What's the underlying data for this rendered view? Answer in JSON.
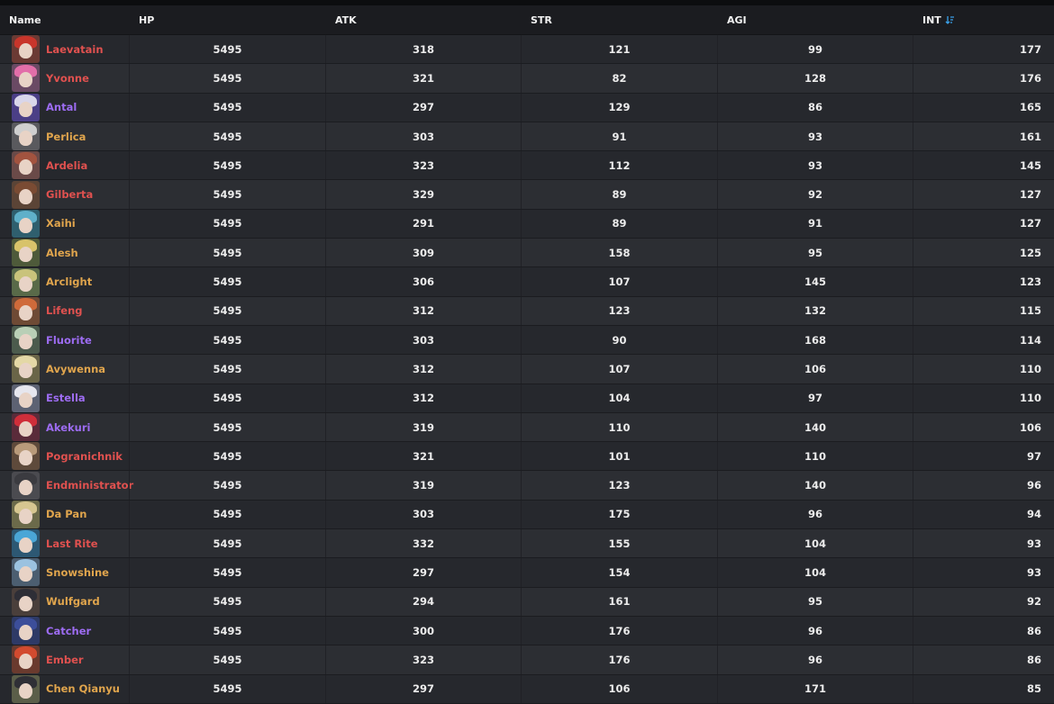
{
  "colors": {
    "red": "#e0514f",
    "purple": "#9d6cf2",
    "gold": "#e0a54d",
    "sort_accent": "#3aa0e8"
  },
  "columns": {
    "name": "Name",
    "hp": "HP",
    "atk": "ATK",
    "str": "STR",
    "agi": "AGI",
    "int": "INT"
  },
  "sort": {
    "column": "INT",
    "direction": "descending",
    "icon": "sort-descending-icon"
  },
  "rows": [
    {
      "name": "Laevatain",
      "rarity": "red",
      "hp": "5495",
      "atk": "318",
      "str": "121",
      "agi": "99",
      "int": "177",
      "avatar": {
        "hair": "#c8352b",
        "bg": "#6b3a34"
      }
    },
    {
      "name": "Yvonne",
      "rarity": "red",
      "hp": "5495",
      "atk": "321",
      "str": "82",
      "agi": "128",
      "int": "176",
      "avatar": {
        "hair": "#e26ea9",
        "bg": "#6a4a64"
      }
    },
    {
      "name": "Antal",
      "rarity": "purple",
      "hp": "5495",
      "atk": "297",
      "str": "129",
      "agi": "86",
      "int": "165",
      "avatar": {
        "hair": "#d9d6ea",
        "bg": "#4b3f86"
      }
    },
    {
      "name": "Perlica",
      "rarity": "gold",
      "hp": "5495",
      "atk": "303",
      "str": "91",
      "agi": "93",
      "int": "161",
      "avatar": {
        "hair": "#cfcfcf",
        "bg": "#5a5a5e"
      }
    },
    {
      "name": "Ardelia",
      "rarity": "red",
      "hp": "5495",
      "atk": "323",
      "str": "112",
      "agi": "93",
      "int": "145",
      "avatar": {
        "hair": "#a2533f",
        "bg": "#6a4a48"
      }
    },
    {
      "name": "Gilberta",
      "rarity": "red",
      "hp": "5495",
      "atk": "329",
      "str": "89",
      "agi": "92",
      "int": "127",
      "avatar": {
        "hair": "#7a4b33",
        "bg": "#5b4436"
      }
    },
    {
      "name": "Xaihi",
      "rarity": "gold",
      "hp": "5495",
      "atk": "291",
      "str": "89",
      "agi": "91",
      "int": "127",
      "avatar": {
        "hair": "#5fb0c9",
        "bg": "#2f5f6e"
      }
    },
    {
      "name": "Alesh",
      "rarity": "gold",
      "hp": "5495",
      "atk": "309",
      "str": "158",
      "agi": "95",
      "int": "125",
      "avatar": {
        "hair": "#d8c36a",
        "bg": "#4e5a3a"
      }
    },
    {
      "name": "Arclight",
      "rarity": "gold",
      "hp": "5495",
      "atk": "306",
      "str": "107",
      "agi": "145",
      "int": "123",
      "avatar": {
        "hair": "#c9c37b",
        "bg": "#596a49"
      }
    },
    {
      "name": "Lifeng",
      "rarity": "red",
      "hp": "5495",
      "atk": "312",
      "str": "123",
      "agi": "132",
      "int": "115",
      "avatar": {
        "hair": "#cf6a3a",
        "bg": "#6e4a35"
      }
    },
    {
      "name": "Fluorite",
      "rarity": "purple",
      "hp": "5495",
      "atk": "303",
      "str": "90",
      "agi": "168",
      "int": "114",
      "avatar": {
        "hair": "#b9cfb6",
        "bg": "#4c5b4d"
      }
    },
    {
      "name": "Avywenna",
      "rarity": "gold",
      "hp": "5495",
      "atk": "312",
      "str": "107",
      "agi": "106",
      "int": "110",
      "avatar": {
        "hair": "#e4d8a6",
        "bg": "#6a6548"
      }
    },
    {
      "name": "Estella",
      "rarity": "purple",
      "hp": "5495",
      "atk": "312",
      "str": "104",
      "agi": "97",
      "int": "110",
      "avatar": {
        "hair": "#e6e6ee",
        "bg": "#5d6273"
      }
    },
    {
      "name": "Akekuri",
      "rarity": "purple",
      "hp": "5495",
      "atk": "319",
      "str": "110",
      "agi": "140",
      "int": "106",
      "avatar": {
        "hair": "#cf2e3a",
        "bg": "#5a2b3a"
      }
    },
    {
      "name": "Pogranichnik",
      "rarity": "red",
      "hp": "5495",
      "atk": "321",
      "str": "101",
      "agi": "110",
      "int": "97",
      "avatar": {
        "hair": "#b89a7a",
        "bg": "#5e4a3b"
      }
    },
    {
      "name": "Endministrator",
      "rarity": "red",
      "hp": "5495",
      "atk": "319",
      "str": "123",
      "agi": "140",
      "int": "96",
      "avatar": {
        "hair": "#3b3b40",
        "bg": "#4b4b50"
      }
    },
    {
      "name": "Da Pan",
      "rarity": "gold",
      "hp": "5495",
      "atk": "303",
      "str": "175",
      "agi": "96",
      "int": "94",
      "avatar": {
        "hair": "#d6c690",
        "bg": "#6b6a4a"
      }
    },
    {
      "name": "Last Rite",
      "rarity": "red",
      "hp": "5495",
      "atk": "332",
      "str": "155",
      "agi": "104",
      "int": "93",
      "avatar": {
        "hair": "#4aa6d6",
        "bg": "#2d5873"
      }
    },
    {
      "name": "Snowshine",
      "rarity": "gold",
      "hp": "5495",
      "atk": "297",
      "str": "154",
      "agi": "104",
      "int": "93",
      "avatar": {
        "hair": "#9bc2e0",
        "bg": "#4c5e70"
      }
    },
    {
      "name": "Wulfgard",
      "rarity": "gold",
      "hp": "5495",
      "atk": "294",
      "str": "161",
      "agi": "95",
      "int": "92",
      "avatar": {
        "hair": "#2e2e36",
        "bg": "#4a3f3b"
      }
    },
    {
      "name": "Catcher",
      "rarity": "purple",
      "hp": "5495",
      "atk": "300",
      "str": "176",
      "agi": "96",
      "int": "86",
      "avatar": {
        "hair": "#3c4e9a",
        "bg": "#2e3a66"
      }
    },
    {
      "name": "Ember",
      "rarity": "red",
      "hp": "5495",
      "atk": "323",
      "str": "176",
      "agi": "96",
      "int": "86",
      "avatar": {
        "hair": "#d24a2f",
        "bg": "#6a3a2e"
      }
    },
    {
      "name": "Chen Qianyu",
      "rarity": "gold",
      "hp": "5495",
      "atk": "297",
      "str": "106",
      "agi": "171",
      "int": "85",
      "avatar": {
        "hair": "#2f2f36",
        "bg": "#5b5e49"
      }
    }
  ]
}
